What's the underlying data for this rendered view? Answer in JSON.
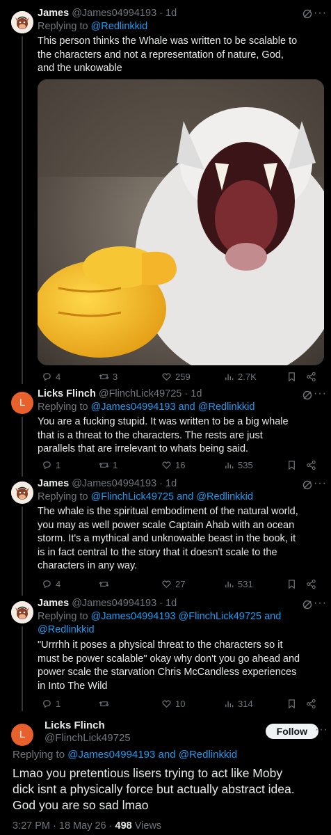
{
  "tweets": [
    {
      "name": "James",
      "handle": "@James04994193",
      "dot": "·",
      "time": "1d",
      "replying_prefix": "Replying to",
      "replying_targets": "@Redlinkkid",
      "text_lines": [
        "This person thinks the Whale was written to be scalable to",
        "the characters and not a representation of nature, God,",
        "and the unkowable"
      ],
      "stats": {
        "replies": "4",
        "reposts": "3",
        "likes": "259",
        "views": "2.7K"
      }
    },
    {
      "name": "Licks Flinch",
      "handle": "@FlinchLick49725",
      "dot": "·",
      "time": "1d",
      "avatar_letter": "L",
      "replying_prefix": "Replying to",
      "replying_targets": "@James04994193 and @Redlinkkid",
      "text_lines": [
        "You are a fucking stupid. It was written to be a big whale",
        "that is a threat to the characters. The rests are just",
        "parallels that are irrelevant to whats being said."
      ],
      "stats": {
        "replies": "1",
        "reposts": "1",
        "likes": "16",
        "views": "535"
      }
    },
    {
      "name": "James",
      "handle": "@James04994193",
      "dot": "·",
      "time": "1d",
      "replying_prefix": "Replying to",
      "replying_targets": "@FlinchLick49725 and @Redlinkkid",
      "text_lines": [
        "The whale is the spiritual embodiment of the natural world,",
        "you may as well power scale Captain Ahab with an ocean",
        "storm. It's a mythical and unknowable beast in the book, it",
        "is in fact central to the story that it doesn't scale to the",
        "characters in any way."
      ],
      "stats": {
        "replies": "4",
        "reposts": "",
        "likes": "27",
        "views": "531"
      }
    },
    {
      "name": "James",
      "handle": "@James04994193",
      "dot": "·",
      "time": "1d",
      "replying_prefix": "Replying to",
      "replying_targets_line1": "@James04994193 @FlinchLick49725 and",
      "replying_targets_line2": "@Redlinkkid",
      "text_lines": [
        "\"Urrrhh it poses a physical threat to the characters so it",
        "must be power scalable\" okay why don't you go ahead and",
        "power scale the starvation Chris McCandless experiences",
        "in Into The Wild"
      ],
      "stats": {
        "replies": "1",
        "reposts": "",
        "likes": "10",
        "views": "314"
      }
    }
  ],
  "main_tweet": {
    "name": "Licks Flinch",
    "handle": "@FlinchLick49725",
    "avatar_letter": "L",
    "follow_label": "Follow",
    "replying_prefix": "Replying to",
    "replying_targets": "@James04994193 and @Redlinkkid",
    "text_lines": [
      "Lmao you pretentious lisers trying to act like Moby",
      "dick isnt a physically force but actually abstract idea.",
      "God you are so sad lmao"
    ],
    "time": "3:27 PM",
    "dot": "·",
    "date": "18 May 26",
    "views_count": "498",
    "views_label": "Views"
  },
  "colors": {
    "background": "#000000",
    "text": "#e7e9ea",
    "muted": "#71767b",
    "link": "#1d9bf0",
    "avatar_orange": "#e8602c"
  }
}
